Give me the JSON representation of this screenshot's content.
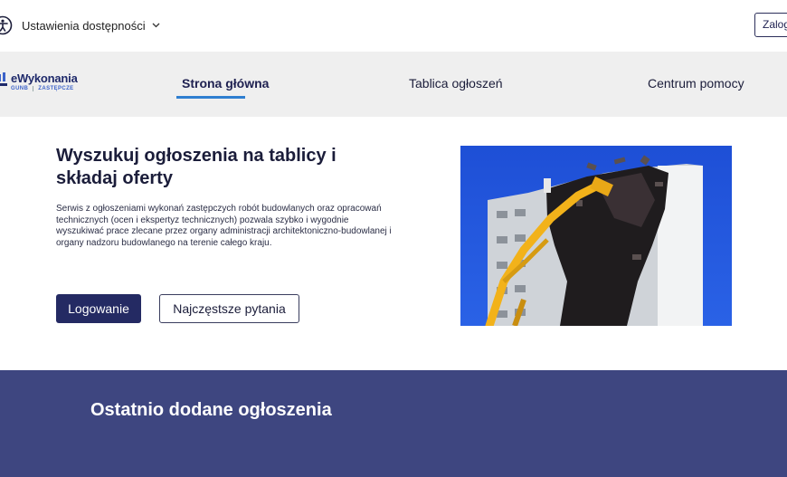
{
  "topbar": {
    "accessibility_label": "Ustawienia dostępności",
    "accessibility_icon": "accessibility-icon",
    "login_label": "Zalog"
  },
  "logo": {
    "name": "eWykonania",
    "org": "GUNB",
    "tagline": "ZASTĘPCZE"
  },
  "nav": {
    "items": [
      {
        "label": "Strona główna",
        "active": true
      },
      {
        "label": "Tablica ogłoszeń",
        "active": false
      },
      {
        "label": "Centrum pomocy",
        "active": false
      }
    ]
  },
  "hero": {
    "title": "Wyszukuj ogłoszenia na tablicy i składaj oferty",
    "description": "Serwis z ogłoszeniami wykonań zastępczych robót budowlanych oraz opracowań technicznych (ocen i ekspertyz technicznych) pozwala szybko i wygodnie wyszukiwać prace zlecane przez organy administracji architektoniczno-budowlanej i organy nadzoru budowlanego na terenie całego kraju.",
    "primary_button": "Logowanie",
    "secondary_button": "Najczęstsze pytania"
  },
  "latest": {
    "title": "Ostatnio dodane ogłoszenia"
  },
  "colors": {
    "navy": "#242a63",
    "accent_blue": "#2f7fd0",
    "section_bg": "#3e4680",
    "nav_bg": "#efefef"
  }
}
